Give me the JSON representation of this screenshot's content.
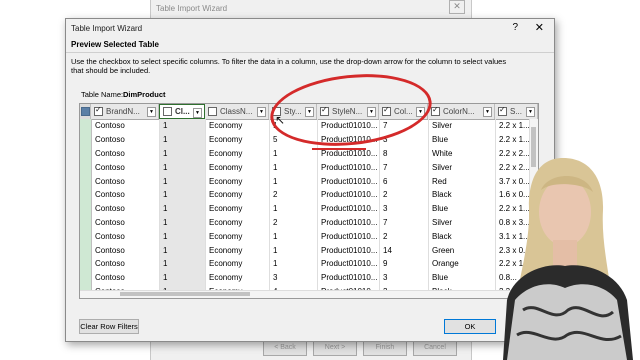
{
  "background_window": {
    "title": "Table Import Wizard",
    "close_glyph": "✕",
    "buttons": [
      "< Back",
      "Next >",
      "Finish",
      "Cancel"
    ]
  },
  "dialog": {
    "title": "Table Import Wizard",
    "help_glyph": "?",
    "close_glyph": "✕",
    "heading": "Preview Selected Table",
    "description": "Use the checkbox to select specific columns. To filter the data in a column, use the drop-down arrow  for the column to select values that should be included.",
    "table_name_label": "Table Name:",
    "table_name_value": "DimProduct",
    "clear_filters_label": "Clear Row Filters",
    "ok_label": "OK"
  },
  "grid": {
    "columns": [
      {
        "label": "BrandN...",
        "checked": true
      },
      {
        "label": "Cl...",
        "checked": false
      },
      {
        "label": "ClassN...",
        "checked": false
      },
      {
        "label": "Sty...",
        "checked": false
      },
      {
        "label": "StyleN...",
        "checked": true
      },
      {
        "label": "Col...",
        "checked": true
      },
      {
        "label": "ColorN...",
        "checked": true
      },
      {
        "label": "S...",
        "checked": true
      }
    ],
    "rows": [
      [
        "Contoso",
        "1",
        "Economy",
        "1",
        "Product01010...",
        "7",
        "Silver",
        "2.2 x 1..."
      ],
      [
        "Contoso",
        "1",
        "Economy",
        "5",
        "Product01010...",
        "3",
        "Blue",
        "2.2 x 1..."
      ],
      [
        "Contoso",
        "1",
        "Economy",
        "1",
        "Product01010...",
        "8",
        "White",
        "2.2 x 2..."
      ],
      [
        "Contoso",
        "1",
        "Economy",
        "1",
        "Product01010...",
        "7",
        "Silver",
        "2.2 x 2..."
      ],
      [
        "Contoso",
        "1",
        "Economy",
        "1",
        "Product01010...",
        "6",
        "Red",
        "3.7 x 0..."
      ],
      [
        "Contoso",
        "1",
        "Economy",
        "2",
        "Product01010...",
        "2",
        "Black",
        "1.6 x 0..."
      ],
      [
        "Contoso",
        "1",
        "Economy",
        "1",
        "Product01010...",
        "3",
        "Blue",
        "2.2 x 1..."
      ],
      [
        "Contoso",
        "1",
        "Economy",
        "2",
        "Product01010...",
        "7",
        "Silver",
        "0.8 x 3..."
      ],
      [
        "Contoso",
        "1",
        "Economy",
        "1",
        "Product01010...",
        "2",
        "Black",
        "3.1 x 1..."
      ],
      [
        "Contoso",
        "1",
        "Economy",
        "1",
        "Product01010...",
        "14",
        "Green",
        "2.3 x 0..."
      ],
      [
        "Contoso",
        "1",
        "Economy",
        "1",
        "Product01010...",
        "9",
        "Orange",
        "2.2 x 1..."
      ],
      [
        "Contoso",
        "1",
        "Economy",
        "3",
        "Product01010...",
        "3",
        "Blue",
        "0.8..."
      ],
      [
        "Contoso",
        "1",
        "Economy",
        "4",
        "Product01010...",
        "2",
        "Black",
        "2.2 x"
      ]
    ]
  },
  "colors": {
    "annotation": "#d42a2a",
    "selected_header_border": "#2f6f2f",
    "row_selector": "#cfe8d3"
  }
}
